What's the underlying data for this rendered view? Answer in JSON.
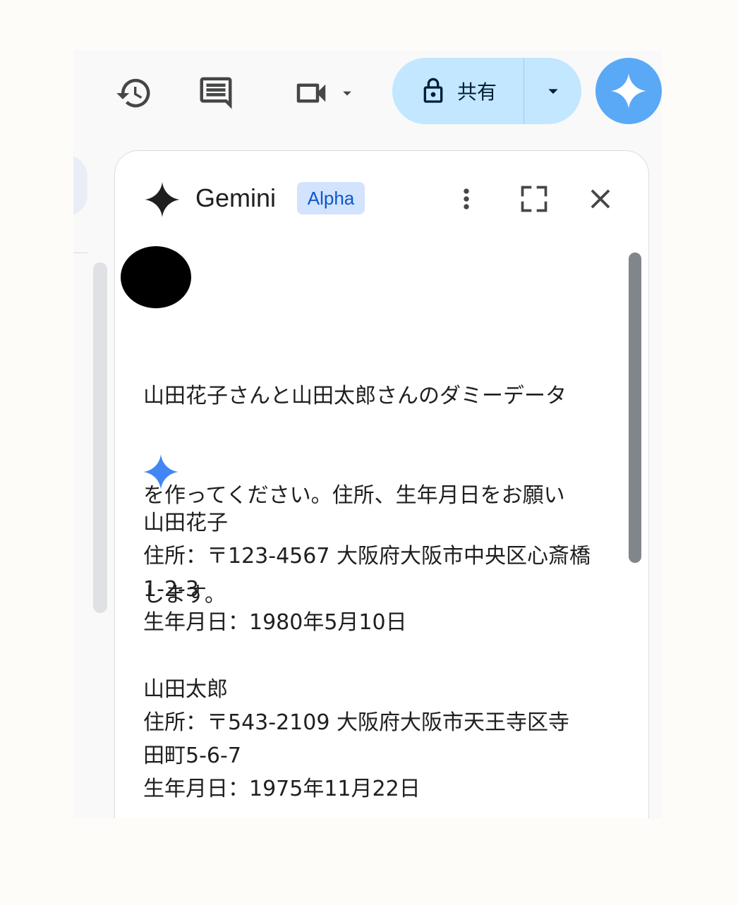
{
  "toolbar": {
    "icons": [
      "history-icon",
      "comment-icon",
      "video-icon",
      "chevron-down-icon"
    ],
    "share_label": "共有",
    "share_icon": "lock-icon"
  },
  "panel": {
    "title": "Gemini",
    "badge": "Alpha",
    "header_icons": [
      "more-vert-icon",
      "fullscreen-icon",
      "close-icon"
    ]
  },
  "conversation": {
    "prompt_lines": [
      "山田花子さんと山田太郎さんのダミーデータ",
      "を作ってください。住所、生年月日をお願い",
      "します。"
    ],
    "response_lines": [
      "山田花子",
      "住所：〒123-4567 大阪府大阪市中央区心斎橋",
      "1-2-3",
      "生年月日：1980年5月10日",
      "",
      "山田太郎",
      "住所：〒543-2109 大阪府大阪市天王寺区寺",
      "田町5-6-7",
      "生年月日：1975年11月22日"
    ]
  },
  "colors": {
    "share_bg": "#c2e7ff",
    "fab_bg": "#5aa9f6",
    "badge_bg": "#d3e3fd",
    "badge_text": "#0b57d0",
    "spark_blue": "#4285f4"
  }
}
